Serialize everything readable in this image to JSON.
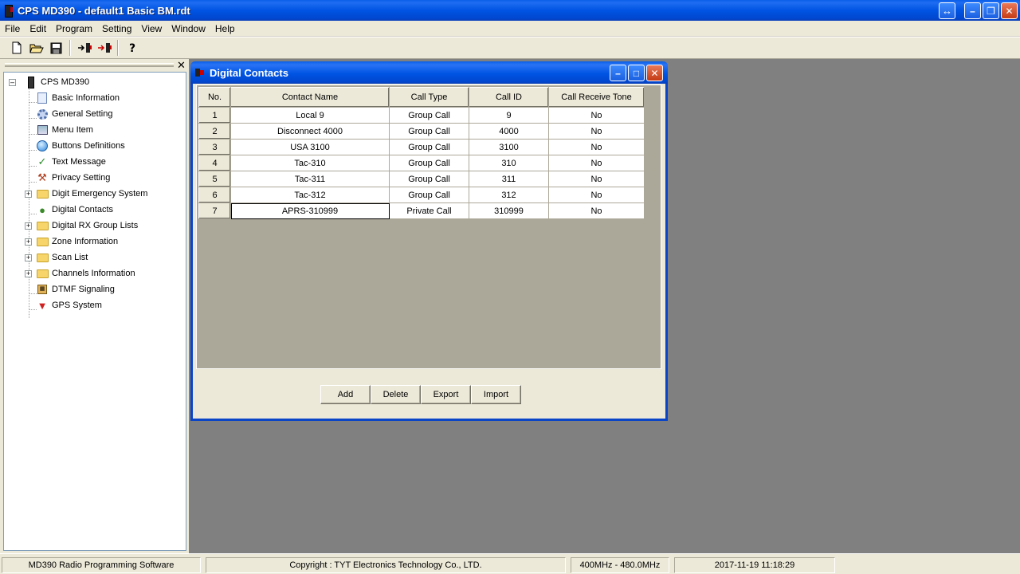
{
  "app": {
    "title": "CPS MD390 - default1 Basic BM.rdt"
  },
  "menu": {
    "items": [
      {
        "label": "File"
      },
      {
        "label": "Edit"
      },
      {
        "label": "Program"
      },
      {
        "label": "Setting"
      },
      {
        "label": "View"
      },
      {
        "label": "Window"
      },
      {
        "label": "Help"
      }
    ]
  },
  "toolbar": {
    "icons": [
      "new-file-icon",
      "open-folder-icon",
      "save-icon",
      "read-from-radio-icon",
      "write-to-radio-icon",
      "help-icon"
    ]
  },
  "tree": {
    "root": "CPS MD390",
    "items": [
      {
        "label": "Basic Information",
        "icon": "document-icon"
      },
      {
        "label": "General Setting",
        "icon": "gear-icon"
      },
      {
        "label": "Menu Item",
        "icon": "menu-icon"
      },
      {
        "label": "Buttons Definitions",
        "icon": "button-icon"
      },
      {
        "label": "Text Message",
        "icon": "checkmark-icon"
      },
      {
        "label": "Privacy Setting",
        "icon": "wrench-icon"
      },
      {
        "label": "Digit Emergency System",
        "icon": "folder-icon"
      },
      {
        "label": "Digital Contacts",
        "icon": "contact-icon"
      },
      {
        "label": "Digital RX Group Lists",
        "icon": "folder-icon"
      },
      {
        "label": "Zone Information",
        "icon": "folder-icon"
      },
      {
        "label": "Scan List",
        "icon": "folder-icon"
      },
      {
        "label": "Channels Information",
        "icon": "folder-icon"
      },
      {
        "label": "DTMF Signaling",
        "icon": "dtmf-icon"
      },
      {
        "label": "GPS System",
        "icon": "gps-icon"
      }
    ]
  },
  "window": {
    "title": "Digital Contacts",
    "columns": [
      "No.",
      "Contact Name",
      "Call Type",
      "Call ID",
      "Call Receive Tone"
    ],
    "rows": [
      {
        "no": "1",
        "name": "Local 9",
        "type": "Group Call",
        "id": "9",
        "tone": "No"
      },
      {
        "no": "2",
        "name": "Disconnect 4000",
        "type": "Group Call",
        "id": "4000",
        "tone": "No"
      },
      {
        "no": "3",
        "name": "USA 3100",
        "type": "Group Call",
        "id": "3100",
        "tone": "No"
      },
      {
        "no": "4",
        "name": "Tac-310",
        "type": "Group Call",
        "id": "310",
        "tone": "No"
      },
      {
        "no": "5",
        "name": "Tac-311",
        "type": "Group Call",
        "id": "311",
        "tone": "No"
      },
      {
        "no": "6",
        "name": "Tac-312",
        "type": "Group Call",
        "id": "312",
        "tone": "No"
      },
      {
        "no": "7",
        "name": "APRS-310999",
        "type": "Private Call",
        "id": "310999",
        "tone": "No"
      }
    ],
    "buttons": {
      "add": "Add",
      "delete": "Delete",
      "export": "Export",
      "import": "Import"
    }
  },
  "status": {
    "app_name": "MD390 Radio Programming Software",
    "copyright": "Copyright : TYT Electronics Technology Co., LTD.",
    "band": "400MHz - 480.0MHz",
    "datetime": "2017-11-19 11:18:29"
  },
  "colors": {
    "titlebar": "#0054e3",
    "chrome": "#ece9d8",
    "mdi_background": "#808080",
    "close_button": "#c43b14"
  }
}
